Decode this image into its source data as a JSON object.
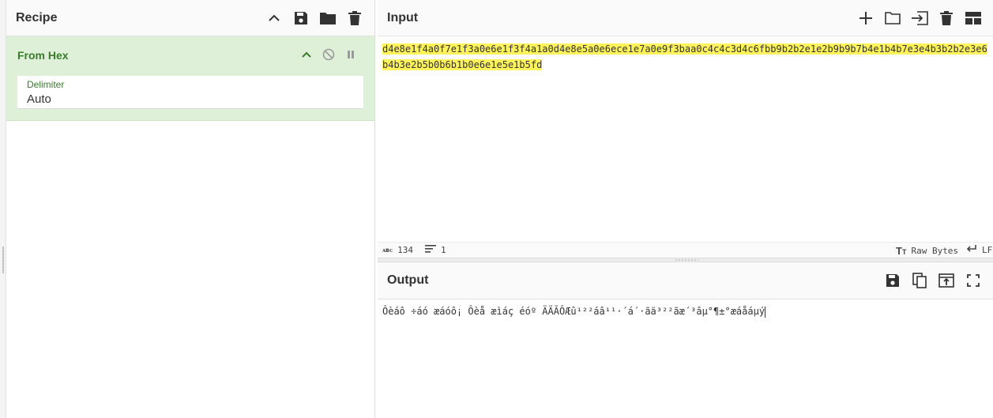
{
  "recipe": {
    "title": "Recipe",
    "operation": {
      "name": "From Hex",
      "delimiter_label": "Delimiter",
      "delimiter_value": "Auto"
    }
  },
  "input": {
    "title": "Input",
    "text": "d4e8e1f4a0f7e1f3a0e6e1f3f4a1a0d4e8e5a0e6ece1e7a0e9f3baa0c4c4c3d4c6fbb9b2b2e1e2b9b9b7b4e1b4b7e3e4b3b2b2e3e6b4b3e2b5b0b6b1b0e6e1e5e1b5fd",
    "status": {
      "char_count": "134",
      "line_count": "1",
      "encoding": "Raw Bytes",
      "eol": "LF",
      "abc_glyph": "ᴀʙᴄ"
    }
  },
  "output": {
    "title": "Output",
    "text": "Ôèáô ÷áó æáóô¡ Ôèå æìáç éóº ÄÄÃÔÆû¹²²áâ¹¹·´á´·ãä³²²ãæ´³âµ°¶±°æáåáµý"
  },
  "colors": {
    "accent_green": "#3b7a2e",
    "operation_bg": "#dff0d8",
    "highlight": "#fff35c"
  },
  "icons": {
    "recipe_header": [
      "chevron-up-icon",
      "save-icon",
      "folder-icon",
      "trash-icon"
    ],
    "operation": [
      "chevron-up-icon",
      "disable-icon",
      "pause-icon"
    ],
    "input_header": [
      "plus-icon",
      "folder-icon",
      "import-icon",
      "trash-icon",
      "layout-icon"
    ],
    "output_header": [
      "save-icon",
      "copy-icon",
      "replace-input-icon",
      "maximize-icon"
    ]
  }
}
